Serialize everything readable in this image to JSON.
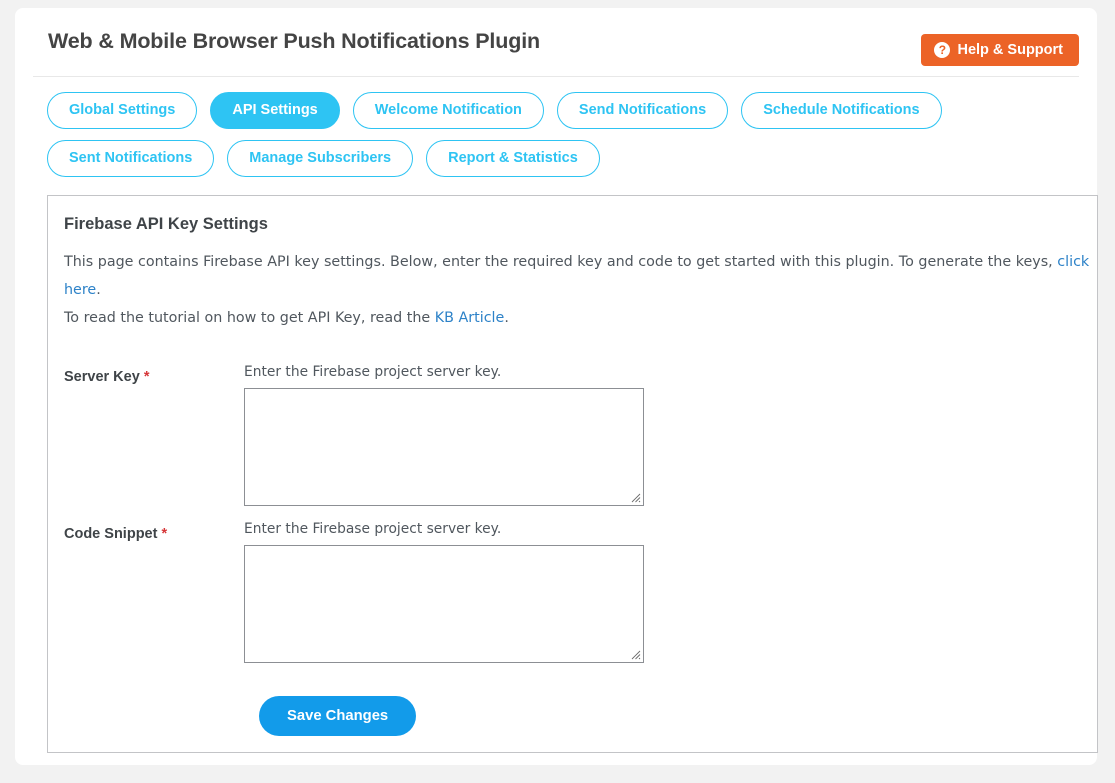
{
  "header": {
    "title": "Web & Mobile Browser Push Notifications Plugin",
    "help_button": {
      "label": "Help & Support",
      "icon": "question-circle-icon",
      "glyph": "?",
      "color": "#ec6327"
    }
  },
  "tabs": {
    "active": "API Settings",
    "items": [
      {
        "label": "Global Settings",
        "active": false
      },
      {
        "label": "API Settings",
        "active": true
      },
      {
        "label": "Welcome Notification",
        "active": false
      },
      {
        "label": "Send Notifications",
        "active": false
      },
      {
        "label": "Schedule Notifications",
        "active": false
      },
      {
        "label": "Sent Notifications",
        "active": false
      },
      {
        "label": "Manage Subscribers",
        "active": false
      },
      {
        "label": "Report & Statistics",
        "active": false
      }
    ],
    "accent_color": "#2ec4f3"
  },
  "panel": {
    "title": "Firebase API Key Settings",
    "description_line1_part1": "This page contains Firebase API key settings. Below, enter the required key and code to get started with this plugin. To generate the keys, ",
    "description_line1_link": "click here",
    "description_line1_part2": ".",
    "description_line2_part1": "To read the tutorial on how to get API Key, read the ",
    "description_line2_link": "KB Article",
    "description_line2_part2": ".",
    "link_color": "#2d82c8"
  },
  "form": {
    "required_marker": "*",
    "fields": [
      {
        "label": "Server Key",
        "required": true,
        "help": "Enter the Firebase project server key.",
        "value": "",
        "placeholder": ""
      },
      {
        "label": "Code Snippet",
        "required": true,
        "help": "Enter the Firebase project server key.",
        "value": "",
        "placeholder": ""
      }
    ],
    "save_label": "Save Changes",
    "save_color": "#129bea"
  }
}
